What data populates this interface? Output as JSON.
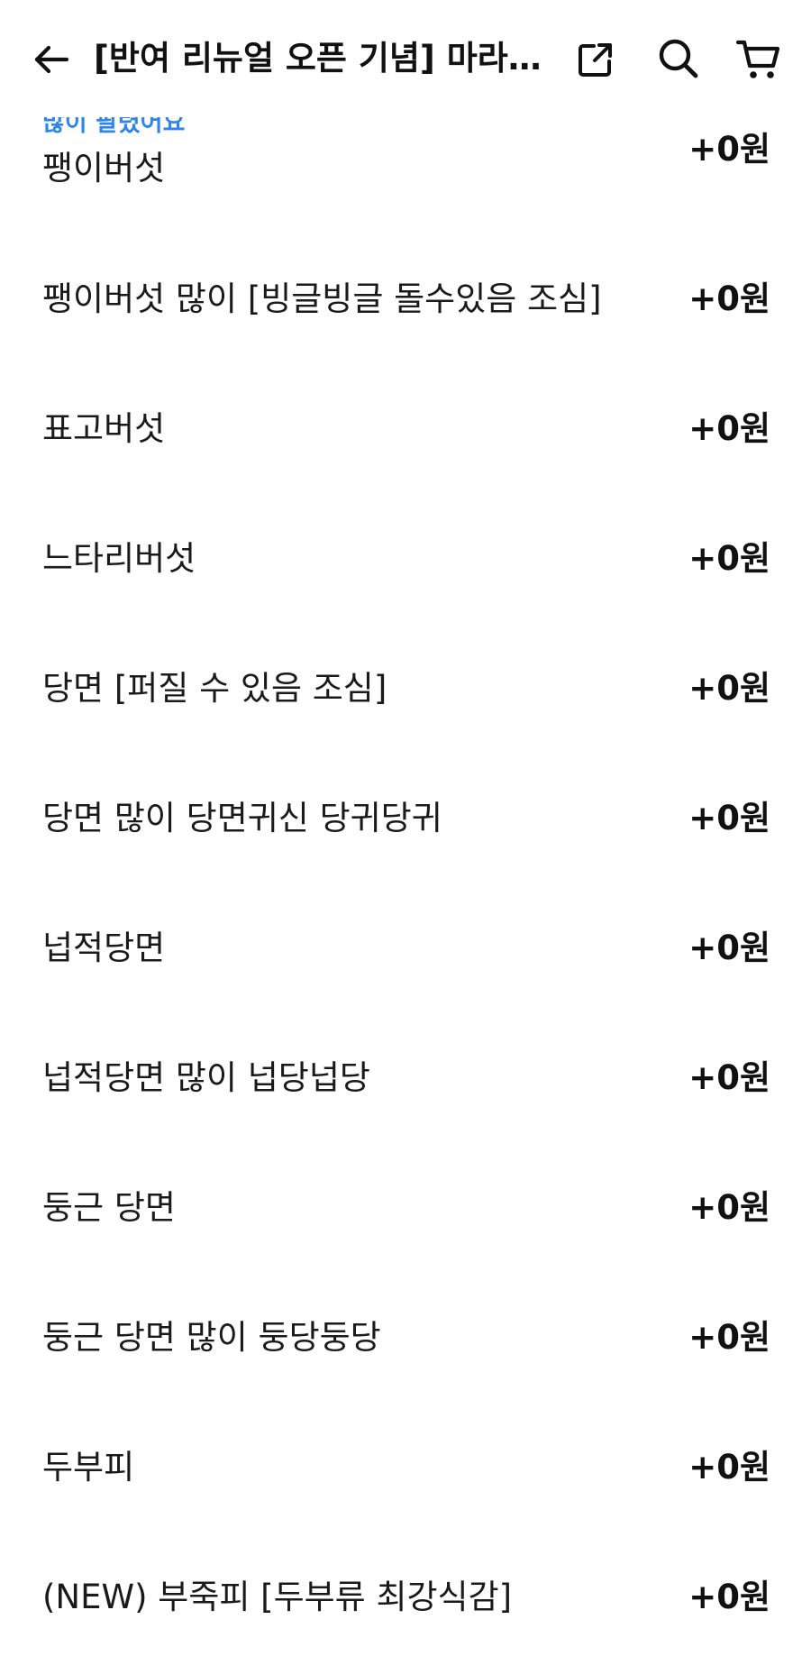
{
  "header": {
    "title": "[반여 리뉴얼 오픈 기념] 마라탕…",
    "icons": {
      "back": "arrow-left-icon",
      "share": "share-icon",
      "search": "search-icon",
      "cart": "cart-icon"
    }
  },
  "options": [
    {
      "badge": "많이 팔렸어요",
      "name": "팽이버섯",
      "price": "+0원"
    },
    {
      "name": "팽이버섯 많이 [빙글빙글 돌수있음 조심]",
      "price": "+0원"
    },
    {
      "name": "표고버섯",
      "price": "+0원"
    },
    {
      "name": "느타리버섯",
      "price": "+0원"
    },
    {
      "name": "당면 [퍼질 수 있음 조심]",
      "price": "+0원"
    },
    {
      "name": "당면 많이 당면귀신 당귀당귀",
      "price": "+0원"
    },
    {
      "name": "넙적당면",
      "price": "+0원"
    },
    {
      "name": "넙적당면 많이 넙당넙당",
      "price": "+0원"
    },
    {
      "name": "둥근 당면",
      "price": "+0원"
    },
    {
      "name": "둥근 당면 많이 둥당둥당",
      "price": "+0원"
    },
    {
      "name": "두부피",
      "price": "+0원"
    },
    {
      "name": "(NEW) 부죽피 [두부류 최강식감]",
      "price": "+0원"
    }
  ],
  "colors": {
    "badge": "#2f86e8",
    "text": "#111111",
    "background": "#ffffff"
  }
}
